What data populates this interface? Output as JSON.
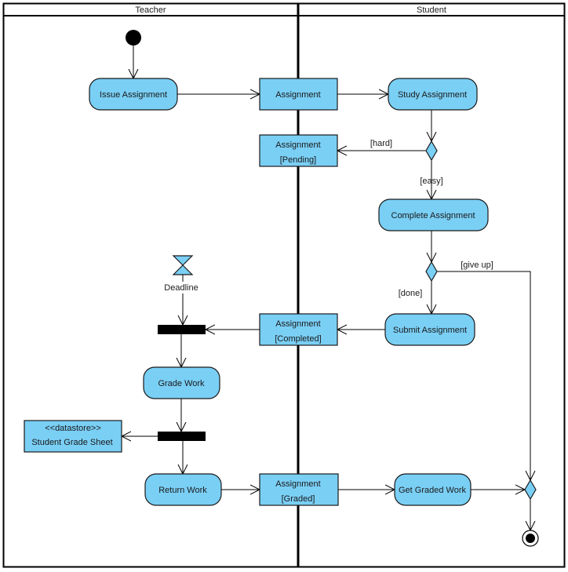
{
  "diagram": {
    "type": "UML Activity Diagram",
    "colors": {
      "node_fill": "#7acff5",
      "line": "#000000",
      "background": "#ffffff"
    },
    "swimlanes": [
      {
        "id": "teacher",
        "label": "Teacher"
      },
      {
        "id": "student",
        "label": "Student"
      }
    ],
    "nodes": {
      "initial": {
        "kind": "initial"
      },
      "issue_assignment": {
        "kind": "action",
        "label": "Issue Assignment",
        "lane": "teacher"
      },
      "assignment": {
        "kind": "object",
        "label": "Assignment"
      },
      "study_assignment": {
        "kind": "action",
        "label": "Study Assignment",
        "lane": "student"
      },
      "decision_difficulty": {
        "kind": "decision"
      },
      "assignment_pending": {
        "kind": "object",
        "label": "Assignment",
        "state": "[Pending]"
      },
      "complete_assignment": {
        "kind": "action",
        "label": "Complete Assignment",
        "lane": "student"
      },
      "decision_done": {
        "kind": "decision"
      },
      "submit_assignment": {
        "kind": "action",
        "label": "Submit Assignment",
        "lane": "student"
      },
      "assignment_completed": {
        "kind": "object",
        "label": "Assignment",
        "state": "[Completed]"
      },
      "deadline": {
        "kind": "time-event",
        "label": "Deadline"
      },
      "join_bar": {
        "kind": "join"
      },
      "grade_work": {
        "kind": "action",
        "label": "Grade Work",
        "lane": "teacher"
      },
      "fork_bar": {
        "kind": "fork"
      },
      "datastore": {
        "kind": "datastore",
        "stereotype": "<<datastore>>",
        "label": "Student Grade Sheet"
      },
      "return_work": {
        "kind": "action",
        "label": "Return Work",
        "lane": "teacher"
      },
      "assignment_graded": {
        "kind": "object",
        "label": "Assignment",
        "state": "[Graded]"
      },
      "get_graded_work": {
        "kind": "action",
        "label": "Get Graded Work",
        "lane": "student"
      },
      "merge": {
        "kind": "merge"
      },
      "final": {
        "kind": "final"
      }
    },
    "guards": {
      "hard": "[hard]",
      "easy": "[easy]",
      "give_up": "[give up]",
      "done": "[done]"
    },
    "edges": [
      {
        "from": "initial",
        "to": "issue_assignment"
      },
      {
        "from": "issue_assignment",
        "to": "assignment"
      },
      {
        "from": "assignment",
        "to": "study_assignment"
      },
      {
        "from": "study_assignment",
        "to": "decision_difficulty"
      },
      {
        "from": "decision_difficulty",
        "to": "assignment_pending",
        "guard": "[hard]"
      },
      {
        "from": "decision_difficulty",
        "to": "complete_assignment",
        "guard": "[easy]"
      },
      {
        "from": "complete_assignment",
        "to": "decision_done"
      },
      {
        "from": "decision_done",
        "to": "submit_assignment",
        "guard": "[done]"
      },
      {
        "from": "decision_done",
        "to": "merge",
        "guard": "[give up]"
      },
      {
        "from": "submit_assignment",
        "to": "assignment_completed"
      },
      {
        "from": "assignment_completed",
        "to": "join_bar"
      },
      {
        "from": "deadline",
        "to": "join_bar"
      },
      {
        "from": "join_bar",
        "to": "grade_work"
      },
      {
        "from": "grade_work",
        "to": "fork_bar"
      },
      {
        "from": "fork_bar",
        "to": "datastore"
      },
      {
        "from": "fork_bar",
        "to": "return_work"
      },
      {
        "from": "return_work",
        "to": "assignment_graded"
      },
      {
        "from": "assignment_graded",
        "to": "get_graded_work"
      },
      {
        "from": "get_graded_work",
        "to": "merge"
      },
      {
        "from": "merge",
        "to": "final"
      }
    ]
  }
}
